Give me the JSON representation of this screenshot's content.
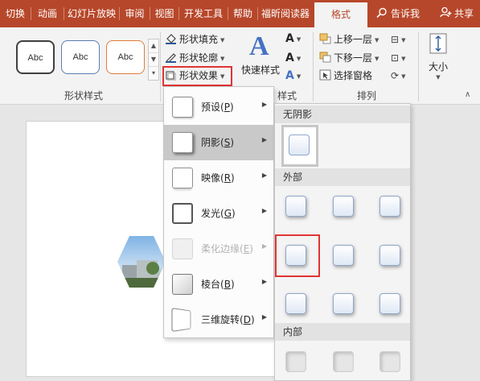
{
  "tabs": {
    "items": [
      "切换",
      "动画",
      "幻灯片放映",
      "审阅",
      "视图",
      "开发工具",
      "帮助",
      "福昕阅读器"
    ],
    "active": "格式",
    "tell_me": "告诉我",
    "share": "共享"
  },
  "colors": {
    "ribbon_accent": "#b7472a",
    "highlight_red": "#e03434",
    "selected_item": "#c9c9c9"
  },
  "ribbon": {
    "shape_styles": {
      "thumbnails": [
        "Abc",
        "Abc",
        "Abc"
      ],
      "thumbnail_border_colors": [
        "#404040",
        "#5b7fae",
        "#e07b39"
      ],
      "group_label": "形状样式"
    },
    "shape_fill": "形状填充",
    "shape_outline": "形状轮廓",
    "shape_effects": "形状效果",
    "quick_styles": "快速样式",
    "art_group_label": "样式",
    "arrange": {
      "bring_forward": "上移一层",
      "send_backward": "下移一层",
      "selection_pane": "选择窗格",
      "group_label": "排列"
    },
    "size_label": "大小"
  },
  "effect_menu": {
    "items": [
      {
        "label": "预设",
        "key": "P",
        "state": "normal"
      },
      {
        "label": "阴影",
        "key": "S",
        "state": "selected"
      },
      {
        "label": "映像",
        "key": "R",
        "state": "normal"
      },
      {
        "label": "发光",
        "key": "G",
        "state": "normal"
      },
      {
        "label": "柔化边缘",
        "key": "E",
        "state": "disabled"
      },
      {
        "label": "棱台",
        "key": "B",
        "state": "normal"
      },
      {
        "label": "三维旋转",
        "key": "D",
        "state": "normal"
      }
    ]
  },
  "shadow_gallery": {
    "no_shadow": "无阴影",
    "outer": "外部",
    "inner": "内部"
  }
}
